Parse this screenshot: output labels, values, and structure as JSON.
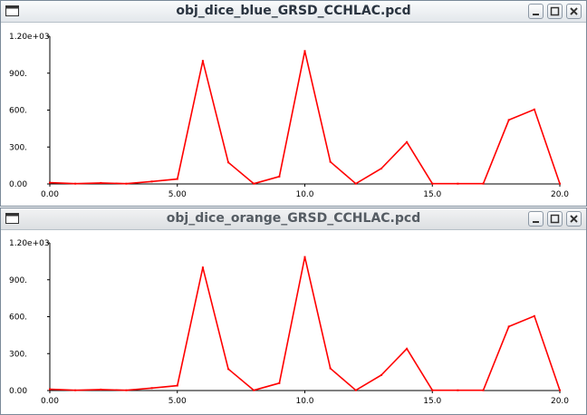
{
  "windows": [
    {
      "title": "obj_dice_blue_GRSD_CCHLAC.pcd",
      "active": true,
      "chart_data": {
        "type": "line",
        "x": [
          0,
          1,
          2,
          3,
          4,
          5,
          6,
          7,
          8,
          9,
          10,
          11,
          12,
          13,
          14,
          15,
          16,
          17,
          18,
          19,
          20
        ],
        "series": [
          {
            "values": [
              10,
              2,
              8,
              2,
              20,
              40,
              1000,
              175,
              2,
              60,
              1080,
              180,
              2,
              125,
              340,
              2,
              2,
              2,
              520,
              605,
              2
            ],
            "color": "#ff0000"
          }
        ],
        "xlim": [
          0,
          20
        ],
        "ylim": [
          0,
          1200
        ],
        "xticks": [
          0,
          5,
          10,
          15,
          20
        ],
        "xtick_labels": [
          "0.00",
          "5.00",
          "10.0",
          "15.0",
          "20.0"
        ],
        "yticks": [
          0,
          300,
          600,
          900,
          1200
        ],
        "ytick_labels": [
          "0.00",
          "300.",
          "600.",
          "900.",
          "1.20e+03"
        ],
        "grid": false
      }
    },
    {
      "title": "obj_dice_orange_GRSD_CCHLAC.pcd",
      "active": false,
      "chart_data": {
        "type": "line",
        "x": [
          0,
          1,
          2,
          3,
          4,
          5,
          6,
          7,
          8,
          9,
          10,
          11,
          12,
          13,
          14,
          15,
          16,
          17,
          18,
          19,
          20
        ],
        "series": [
          {
            "values": [
              10,
              2,
              8,
              2,
              20,
              40,
              1000,
              175,
              2,
              60,
              1085,
              180,
              2,
              125,
              340,
              2,
              2,
              2,
              520,
              605,
              2
            ],
            "color": "#ff0000"
          }
        ],
        "xlim": [
          0,
          20
        ],
        "ylim": [
          0,
          1200
        ],
        "xticks": [
          0,
          5,
          10,
          15,
          20
        ],
        "xtick_labels": [
          "0.00",
          "5.00",
          "10.0",
          "15.0",
          "20.0"
        ],
        "yticks": [
          0,
          300,
          600,
          900,
          1200
        ],
        "ytick_labels": [
          "0.00",
          "300.",
          "600.",
          "900.",
          "1.20e+03"
        ],
        "grid": false
      }
    }
  ]
}
